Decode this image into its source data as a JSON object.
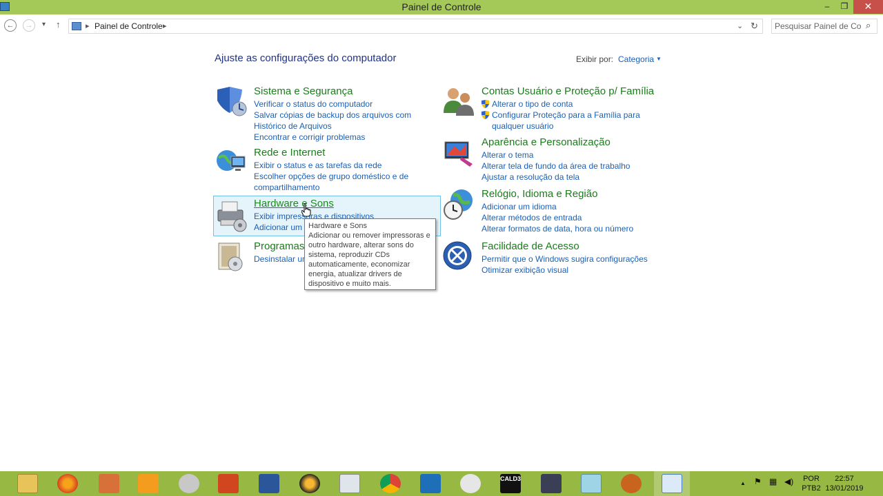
{
  "window": {
    "title": "Painel de Controle",
    "minimize": "–",
    "maximize": "❐",
    "close": "✕"
  },
  "nav": {
    "back": "←",
    "forward": "→",
    "recent": "▾",
    "up": "↑"
  },
  "address": {
    "sep": "▸",
    "crumb": "Painel de Controle",
    "dropdown": "⌄",
    "refresh": "↻"
  },
  "search": {
    "placeholder": "Pesquisar Painel de Co...",
    "icon": "⌕"
  },
  "main": {
    "heading": "Ajuste as configurações do computador",
    "view_by_label": "Exibir por:",
    "view_by_value": "Categoria"
  },
  "categories": {
    "system": {
      "title": "Sistema e Segurança",
      "links": [
        "Verificar o status do computador",
        "Salvar cópias de backup dos arquivos com Histórico de Arquivos",
        "Encontrar e corrigir problemas"
      ]
    },
    "network": {
      "title": "Rede e Internet",
      "links": [
        "Exibir o status e as tarefas da rede",
        "Escolher opções de grupo doméstico e de compartilhamento"
      ]
    },
    "hardware": {
      "title": "Hardware e Sons",
      "links": [
        "Exibir impressoras e dispositivos",
        "Adicionar um dispositivo"
      ]
    },
    "programs": {
      "title": "Programas",
      "links": [
        "Desinstalar um programa"
      ]
    },
    "accounts": {
      "title": "Contas Usuário e Proteção p/ Família",
      "links": [
        "Alterar o tipo de conta",
        "Configurar Proteção para a Família para qualquer usuário"
      ]
    },
    "appearance": {
      "title": "Aparência e Personalização",
      "links": [
        "Alterar o tema",
        "Alterar tela de fundo da área de trabalho",
        "Ajustar a resolução da tela"
      ]
    },
    "clock": {
      "title": "Relógio, Idioma e Região",
      "links": [
        "Adicionar um idioma",
        "Alterar métodos de entrada",
        "Alterar formatos de data, hora ou número"
      ]
    },
    "ease": {
      "title": "Facilidade de Acesso",
      "links": [
        "Permitir que o Windows sugira configurações",
        "Otimizar exibição visual"
      ]
    }
  },
  "tooltip": {
    "title": "Hardware e Sons",
    "body": "Adicionar ou remover impressoras e outro hardware, alterar sons do sistema, reproduzir CDs automaticamente, economizar energia, atualizar drivers de dispositivo e muito mais."
  },
  "taskbar": {
    "apps": [
      "file-explorer",
      "firefox",
      "office-tools",
      "media-player",
      "photo-tool",
      "powerpoint",
      "word",
      "fl-studio",
      "system-monitor",
      "chrome",
      "media-center",
      "paint",
      "cald3",
      "video-tool",
      "glass-app",
      "baseball-glove-app",
      "control-panel"
    ],
    "cald_label": "CALD3",
    "tray_up": "▲",
    "lang_top": "POR",
    "lang_bottom": "PTB2",
    "time": "22:57",
    "date": "13/01/2019"
  }
}
